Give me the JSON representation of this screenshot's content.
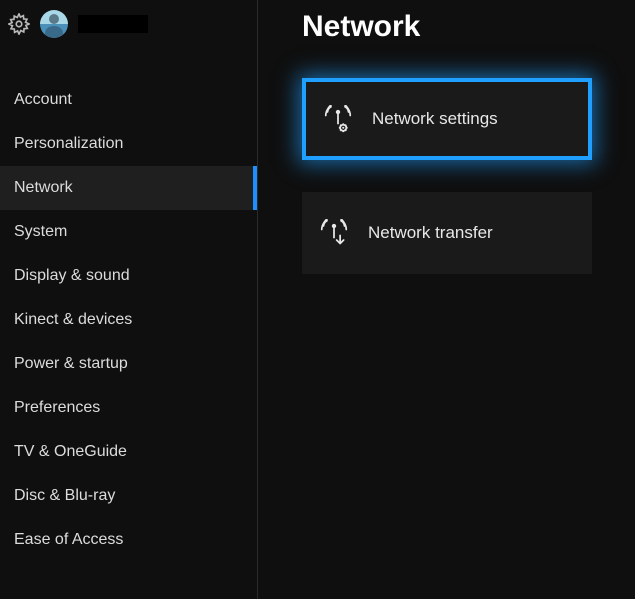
{
  "page_title": "Network",
  "sidebar": {
    "items": [
      {
        "label": "Account"
      },
      {
        "label": "Personalization"
      },
      {
        "label": "Network"
      },
      {
        "label": "System"
      },
      {
        "label": "Display & sound"
      },
      {
        "label": "Kinect & devices"
      },
      {
        "label": "Power & startup"
      },
      {
        "label": "Preferences"
      },
      {
        "label": "TV & OneGuide"
      },
      {
        "label": "Disc & Blu-ray"
      },
      {
        "label": "Ease of Access"
      }
    ],
    "active_index": 2
  },
  "tiles": [
    {
      "label": "Network settings",
      "icon": "antenna-gear-icon",
      "selected": true
    },
    {
      "label": "Network transfer",
      "icon": "antenna-down-icon",
      "selected": false
    }
  ]
}
